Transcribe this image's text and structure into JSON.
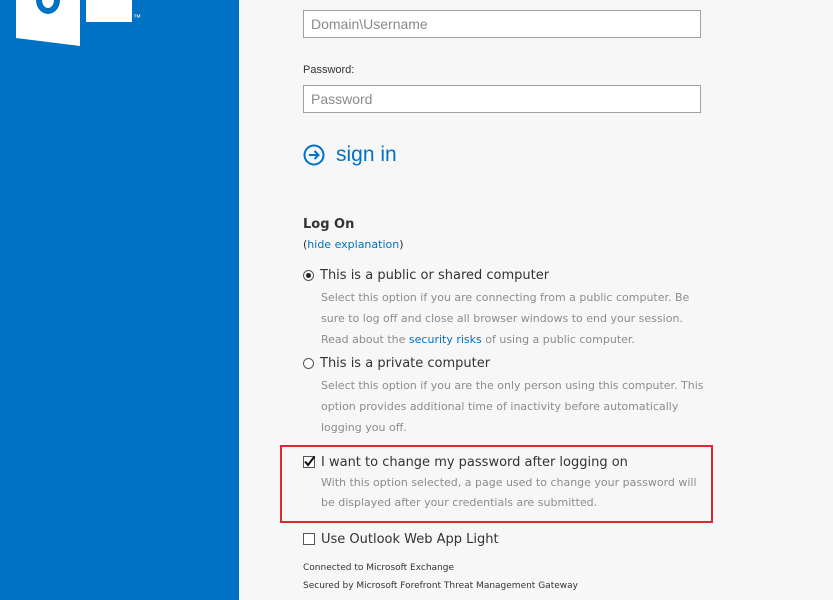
{
  "app": {
    "trademark": "™"
  },
  "username": {
    "placeholder": "Domain\\Username"
  },
  "password": {
    "label": "Password:",
    "placeholder": "Password"
  },
  "signin": {
    "label": "sign in",
    "icon": "arrow-circle-right-icon"
  },
  "logon": {
    "title": "Log On",
    "open_paren": "(",
    "hide_link": "hide explanation",
    "close_paren": ")"
  },
  "options": {
    "public": {
      "label": "This is a public or shared computer",
      "checked": true,
      "desc_part1": "Select this option if you are connecting from a public computer. Be sure to log off and close all browser windows to end your session. Read about the ",
      "desc_link": "security risks",
      "desc_part2": " of using a public computer."
    },
    "private": {
      "label": "This is a private computer",
      "checked": false,
      "desc": "Select this option if you are the only person using this computer. This option provides additional time of inactivity before automatically logging you off."
    },
    "change_password": {
      "label": "I want to change my password after logging on",
      "checked": true,
      "desc": "With this option selected, a page used to change your password will be displayed after your credentials are submitted."
    },
    "light": {
      "label": "Use Outlook Web App Light",
      "checked": false
    }
  },
  "footer": {
    "connected": "Connected to Microsoft Exchange",
    "secured": "Secured by Microsoft Forefront Threat Management Gateway"
  },
  "colors": {
    "brand_blue": "#0072c6",
    "highlight_red": "#e0262e",
    "content_bg": "#f7f7f7"
  }
}
